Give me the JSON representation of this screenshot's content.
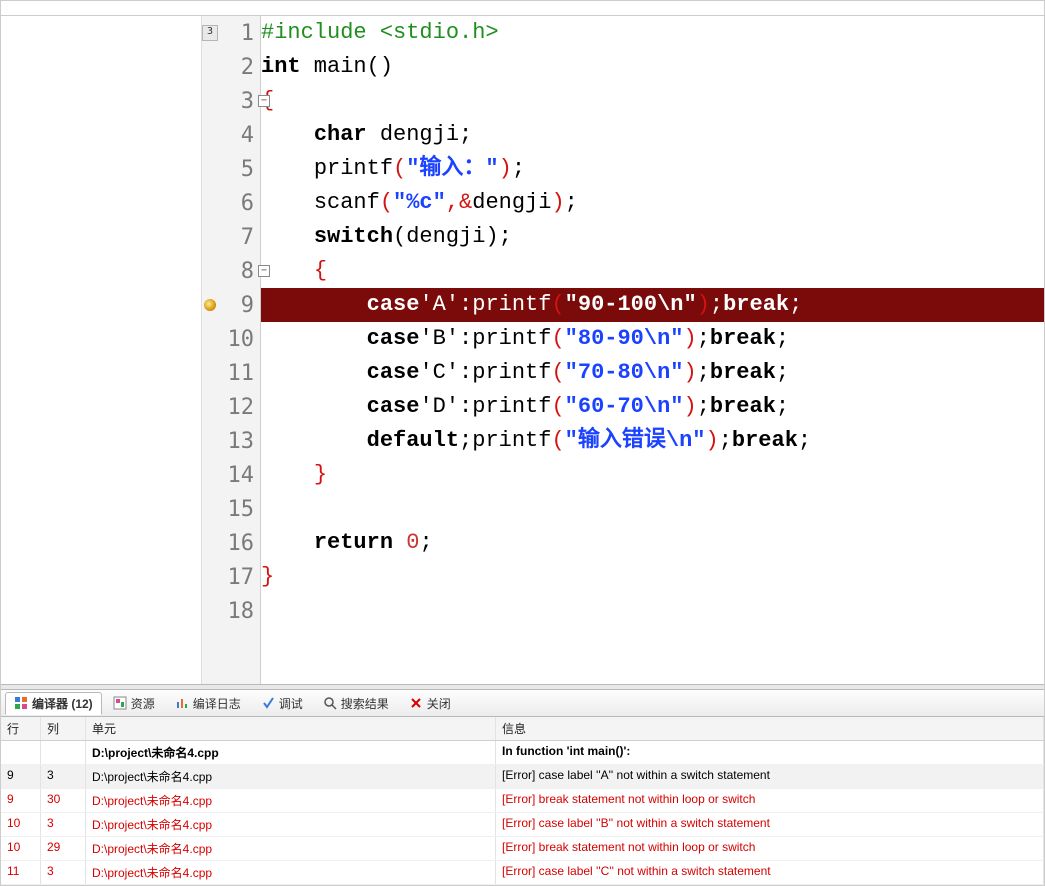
{
  "gutter": {
    "lines": [
      "1",
      "2",
      "3",
      "4",
      "5",
      "6",
      "7",
      "8",
      "9",
      "10",
      "11",
      "12",
      "13",
      "14",
      "15",
      "16",
      "17",
      "18"
    ],
    "bookmark_line": 1,
    "bookmark_text": "3",
    "error_marker_line": 9,
    "fold_lines": [
      3,
      8
    ]
  },
  "code": {
    "l1_pp": "#include <stdio.h>",
    "l2_kw": "int",
    "l2_rest": " main()",
    "l3": "{",
    "l4_indent": "    ",
    "l4_kw": "char",
    "l4_rest": " dengji;",
    "l5_indent": "    ",
    "l5_fn": "printf",
    "l5_p1": "(",
    "l5_str": "\"输入：\"",
    "l5_p2": ")",
    "l5_sc": ";",
    "l6_indent": "    ",
    "l6_fn": "scanf",
    "l6_p1": "(",
    "l6_str": "\"%c\"",
    "l6_cm": ",",
    "l6_amp": "&",
    "l6_id": "dengji",
    "l6_p2": ")",
    "l6_sc": ";",
    "l7_indent": "    ",
    "l7_kw": "switch",
    "l7_rest": "(dengji);",
    "l8_indent": "    ",
    "l8": "{",
    "l9_indent": "        ",
    "l9_kw": "case",
    "l9_ch": "'A'",
    "l9_col": ":",
    "l9_fn": "printf",
    "l9_p1": "(",
    "l9_str": "\"90-100\\n\"",
    "l9_p2": ")",
    "l9_sc1": ";",
    "l9_bk": "break",
    "l9_sc2": ";",
    "l10_indent": "        ",
    "l10_kw": "case",
    "l10_ch": "'B'",
    "l10_col": ":",
    "l10_fn": "printf",
    "l10_p1": "(",
    "l10_str": "\"80-90\\n\"",
    "l10_p2": ")",
    "l10_sc1": ";",
    "l10_bk": "break",
    "l10_sc2": ";",
    "l11_indent": "        ",
    "l11_kw": "case",
    "l11_ch": "'C'",
    "l11_col": ":",
    "l11_fn": "printf",
    "l11_p1": "(",
    "l11_str": "\"70-80\\n\"",
    "l11_p2": ")",
    "l11_sc1": ";",
    "l11_bk": "break",
    "l11_sc2": ";",
    "l12_indent": "        ",
    "l12_kw": "case",
    "l12_ch": "'D'",
    "l12_col": ":",
    "l12_fn": "printf",
    "l12_p1": "(",
    "l12_str": "\"60-70\\n\"",
    "l12_p2": ")",
    "l12_sc1": ";",
    "l12_bk": "break",
    "l12_sc2": ";",
    "l13_indent": "        ",
    "l13_kw": "default",
    "l13_sc0": ";",
    "l13_fn": "printf",
    "l13_p1": "(",
    "l13_str": "\"输入错误\\n\"",
    "l13_p2": ")",
    "l13_sc1": ";",
    "l13_bk": "break",
    "l13_sc2": ";",
    "l14_indent": "    ",
    "l14": "}",
    "l15": "",
    "l16_indent": "    ",
    "l16_kw": "return",
    "l16_rest": " 0;",
    "l17": "}",
    "l18": ""
  },
  "tabs": {
    "compiler": "编译器 (12)",
    "resources": "资源",
    "log": "编译日志",
    "debug": "调试",
    "search": "搜索结果",
    "close": "关闭"
  },
  "msg": {
    "head": {
      "line": "行",
      "col": "列",
      "unit": "单元",
      "info": "信息"
    },
    "rows": [
      {
        "line": "",
        "col": "",
        "unit": "D:\\project\\未命名4.cpp",
        "info": "In function 'int main()':",
        "cls": "hdr"
      },
      {
        "line": "9",
        "col": "3",
        "unit": "D:\\project\\未命名4.cpp",
        "info": "[Error] case label ''A'' not within a switch statement",
        "cls": "sel"
      },
      {
        "line": "9",
        "col": "30",
        "unit": "D:\\project\\未命名4.cpp",
        "info": "[Error] break statement not within loop or switch",
        "cls": "err"
      },
      {
        "line": "10",
        "col": "3",
        "unit": "D:\\project\\未命名4.cpp",
        "info": "[Error] case label ''B'' not within a switch statement",
        "cls": "err"
      },
      {
        "line": "10",
        "col": "29",
        "unit": "D:\\project\\未命名4.cpp",
        "info": "[Error] break statement not within loop or switch",
        "cls": "err"
      },
      {
        "line": "11",
        "col": "3",
        "unit": "D:\\project\\未命名4.cpp",
        "info": "[Error] case label ''C'' not within a switch statement",
        "cls": "err"
      }
    ]
  }
}
